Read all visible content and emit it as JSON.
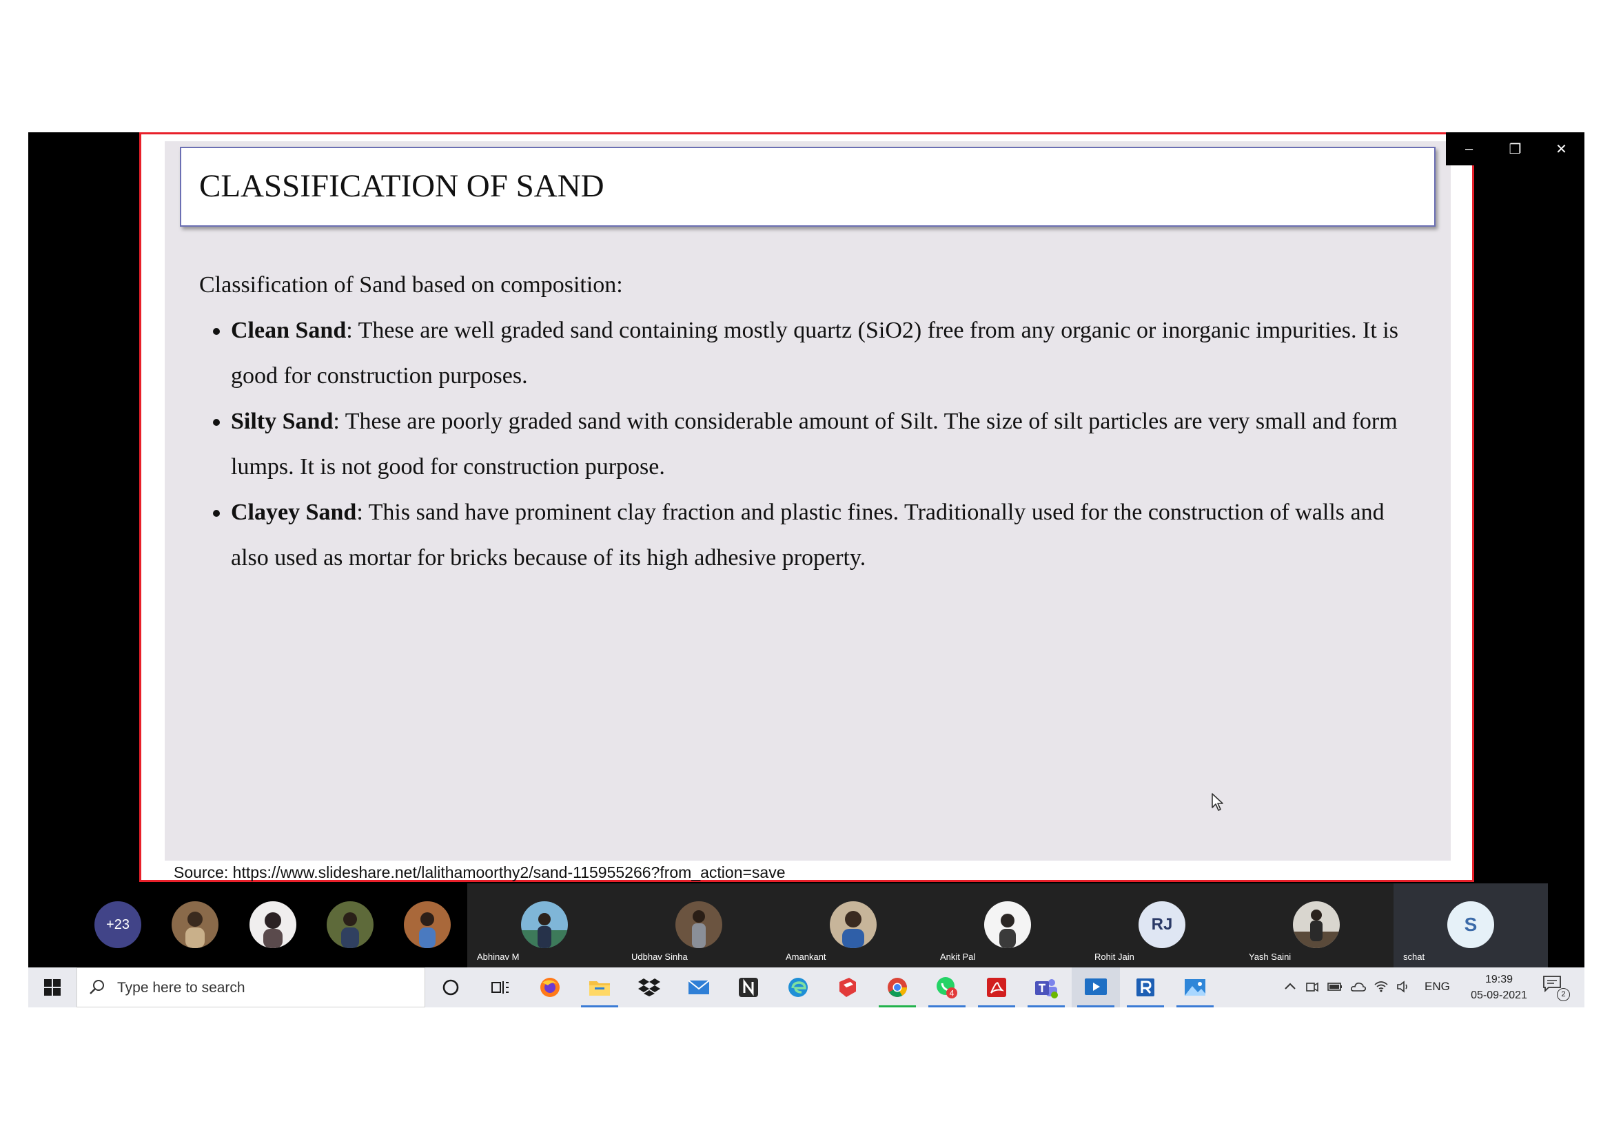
{
  "slide": {
    "title": "CLASSIFICATION OF SAND",
    "intro": "Classification of Sand based on composition:",
    "bullets": [
      {
        "term": "Clean Sand",
        "text": ": These are well graded sand containing mostly quartz (SiO2) free from any organic or inorganic impurities. It is good for construction purposes."
      },
      {
        "term": "Silty Sand",
        "text": ": These are poorly graded sand with considerable amount of Silt. The size of silt particles are very small and form lumps. It is not good for construction purpose."
      },
      {
        "term": "Clayey Sand",
        "text": ": This sand have prominent clay fraction and plastic fines. Traditionally used for the construction of walls and also used as mortar for bricks because of its high adhesive property."
      }
    ],
    "source": "Source: https://www.slideshare.net/lalithamoorthy2/sand-115955266?from_action=save"
  },
  "window_controls": {
    "minimize": "–",
    "restore": "❐",
    "close": "✕"
  },
  "participants": {
    "more_count": "+23",
    "tiles": [
      {
        "name": "Abhinav M"
      },
      {
        "name": "Udbhav Sinha"
      },
      {
        "name": "Amankant"
      },
      {
        "name": "Ankit Pal"
      },
      {
        "name": "Rohit Jain",
        "initials": "RJ"
      },
      {
        "name": "Yash Saini"
      },
      {
        "name": "schat",
        "initials": "S"
      }
    ]
  },
  "taskbar": {
    "search_placeholder": "Type here to search",
    "whatsapp_badge": "4",
    "tray": {
      "language": "ENG",
      "time": "19:39",
      "date": "05-09-2021",
      "notification_count": "2"
    }
  },
  "colors": {
    "share_border": "#e8202a",
    "title_border": "#6b6fb3",
    "slide_bg": "#e8e5ea",
    "avatar_more": "#414488"
  }
}
